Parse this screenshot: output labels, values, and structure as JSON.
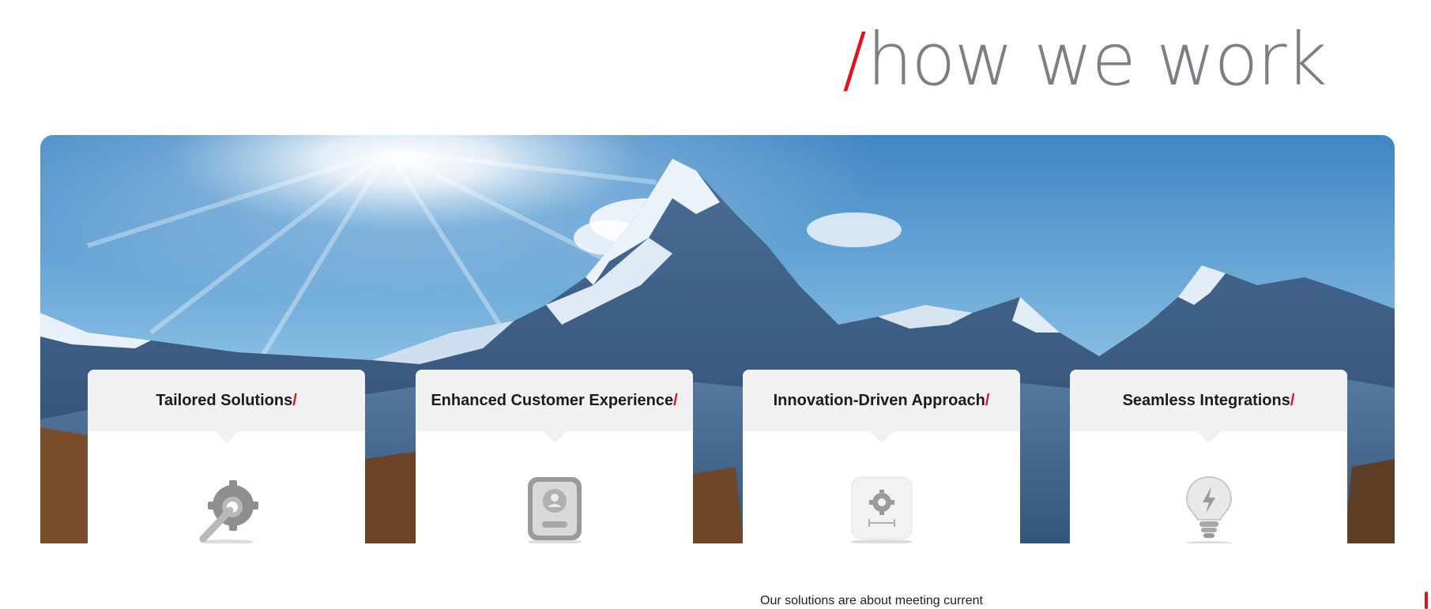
{
  "section": {
    "slash": "/",
    "title": "how we work"
  },
  "cards": [
    {
      "title": "Tailored Solutions",
      "slash": "/",
      "icon": "wrench-gear-icon"
    },
    {
      "title": "Enhanced Customer Experience",
      "slash": "/",
      "icon": "user-profile-icon"
    },
    {
      "title": "Innovation-Driven Approach",
      "slash": "/",
      "icon": "settings-gear-icon"
    },
    {
      "title": "Seamless Integrations",
      "slash": "/",
      "icon": "lightbulb-icon"
    }
  ],
  "intro_text": "Our solutions are about meeting current",
  "colors": {
    "accent": "#e2111b",
    "heading": "#7d7f86",
    "card_header": "#f1f1f2"
  }
}
